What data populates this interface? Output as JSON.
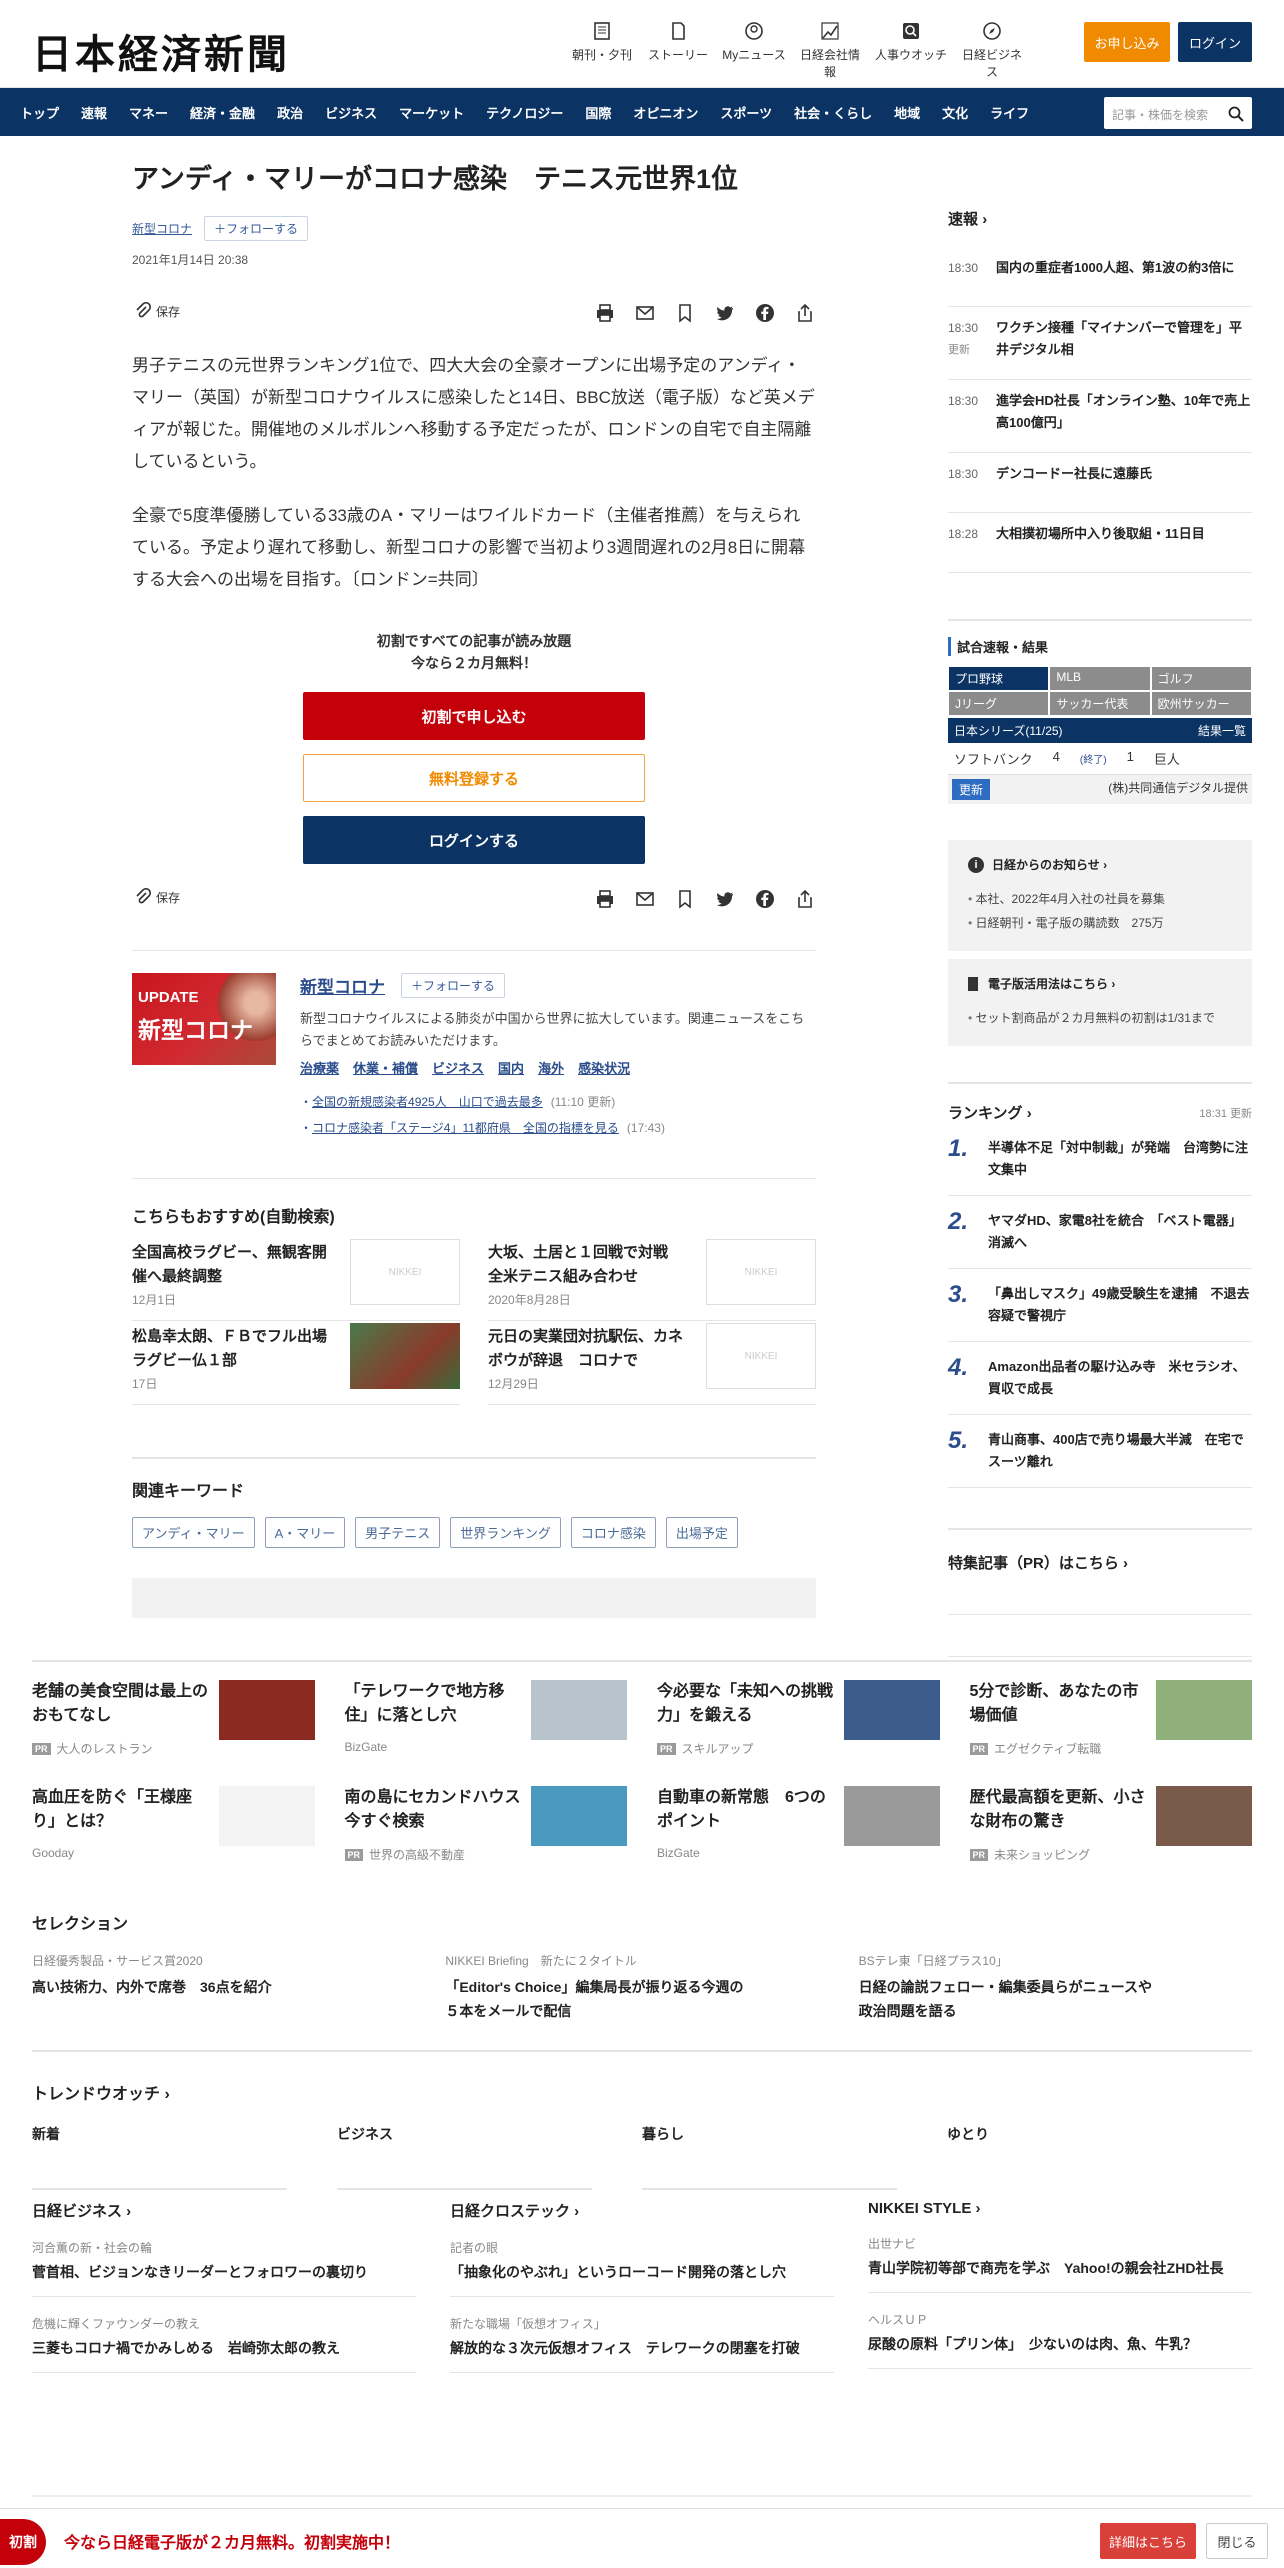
{
  "header": {
    "logo": "日本経済新聞",
    "nav": [
      {
        "label": "朝刊・夕刊",
        "icon": "newspaper-icon"
      },
      {
        "label": "ストーリー",
        "icon": "story-icon"
      },
      {
        "label": "Myニュース",
        "icon": "user-icon"
      },
      {
        "label": "日経会社情報",
        "icon": "chart-icon"
      },
      {
        "label": "人事ウオッチ",
        "icon": "search-person-icon"
      },
      {
        "label": "日経ビジネス",
        "icon": "compass-icon"
      }
    ],
    "apply_label": "お申し込み",
    "login_label": "ログイン"
  },
  "gnav": {
    "items": [
      "トップ",
      "速報",
      "マネー",
      "経済・金融",
      "政治",
      "ビジネス",
      "マーケット",
      "テクノロジー",
      "国際",
      "オピニオン",
      "スポーツ",
      "社会・くらし",
      "地域",
      "文化",
      "ライフ"
    ],
    "search_placeholder": "記事・株価を検索"
  },
  "article": {
    "title": "アンディ・マリーがコロナ感染　テニス元世界1位",
    "topic": "新型コロナ",
    "follow": "フォローする",
    "date": "2021年1月14日 20:38",
    "save": "保存",
    "paragraphs": [
      "男子テニスの元世界ランキング1位で、四大大会の全豪オープンに出場予定のアンディ・マリー（英国）が新型コロナウイルスに感染したと14日、BBC放送（電子版）など英メディアが報じた。開催地のメルボルンへ移動する予定だったが、ロンドンの自宅で自主隔離しているという。",
      "全豪で5度準優勝している33歳のA・マリーはワイルドカード（主催者推薦）を与えられている。予定より遅れて移動し、新型コロナの影響で当初より3週間遅れの2月8日に開幕する大会への出場を目指す。〔ロンドン=共同〕"
    ]
  },
  "paywall": {
    "line1": "初割ですべての記事が読み放題",
    "line2": "今なら２カ月無料！",
    "btn1": "初割で申し込む",
    "btn2": "無料登録する",
    "btn3": "ログインする"
  },
  "topic_box": {
    "img_update": "UPDATE",
    "img_caption": "新型コロナ",
    "title": "新型コロナ",
    "follow": "フォローする",
    "desc": "新型コロナウイルスによる肺炎が中国から世界に拡大しています。関連ニュースをこちらでまとめてお読みいただけます。",
    "tags": [
      "治療薬",
      "休業・補償",
      "ビジネス",
      "国内",
      "海外",
      "感染状況"
    ],
    "links": [
      {
        "text": "全国の新規感染者4925人　山口で過去最多",
        "time": "(11:10 更新)"
      },
      {
        "text": "コロナ感染者「ステージ4」11都府県　全国の指標を見る",
        "time": "(17:43)"
      }
    ]
  },
  "recommend": {
    "heading": "こちらもおすすめ(自動検索)",
    "items": [
      {
        "title": "全国高校ラグビー、無観客開催へ最終調整",
        "date": "12月1日",
        "img": "NIKKEI"
      },
      {
        "title": "大坂、土居と１回戦で対戦　全米テニス組み合わせ",
        "date": "2020年8月28日",
        "img": "NIKKEI"
      },
      {
        "title": "松島幸太朗、ＦＢでフル出場　ラグビー仏１部",
        "date": "17日",
        "img": ""
      },
      {
        "title": "元日の実業団対抗駅伝、カネボウが辞退　コロナで",
        "date": "12月29日",
        "img": "NIKKEI"
      }
    ]
  },
  "keywords": {
    "heading": "関連キーワード",
    "items": [
      "アンディ・マリー",
      "A・マリー",
      "男子テニス",
      "世界ランキング",
      "コロナ感染",
      "出場予定"
    ]
  },
  "sidebar": {
    "sokuho_heading": "速報",
    "sokuho": [
      {
        "time": "18:30",
        "sub": "",
        "text": "国内の重症者1000人超、第1波の約3倍に"
      },
      {
        "time": "18:30",
        "sub": "更新",
        "text": "ワクチン接種「マイナンバーで管理を」平井デジタル相"
      },
      {
        "time": "18:30",
        "sub": "",
        "text": "進学会HD社長「オンライン塾、10年で売上高100億円」"
      },
      {
        "time": "18:30",
        "sub": "",
        "text": "デンコードー社長に遠藤氏"
      },
      {
        "time": "18:28",
        "sub": "",
        "text": "大相撲初場所中入り後取組・11日目"
      }
    ],
    "score": {
      "heading": "試合速報・結果",
      "tabs": [
        "プロ野球",
        "MLB",
        "ゴルフ",
        "Jリーグ",
        "サッカー代表",
        "欧州サッカー"
      ],
      "bar_left": "日本シリーズ(11/25)",
      "bar_right": "結果一覧",
      "row": {
        "home": "ソフトバンク",
        "hs": "4",
        "status": "(終了)",
        "as": "1",
        "away": "巨人"
      },
      "update": "更新",
      "provider": "(株)共同通信デジタル提供"
    },
    "notice": {
      "heading": "日経からのお知らせ",
      "items": [
        "本社、2022年4月入社の社員を募集",
        "日経朝刊・電子版の購読数　275万"
      ]
    },
    "notice2": {
      "heading": "電子版活用法はこちら",
      "items": [
        "セット割商品が２カ月無料の初割は1/31まで"
      ]
    },
    "ranking": {
      "heading": "ランキング",
      "time": "18:31 更新",
      "items": [
        {
          "n": "1.",
          "t": "半導体不足「対中制裁」が発端　台湾勢に注文集中"
        },
        {
          "n": "2.",
          "t": "ヤマダHD、家電8社を統合　「ベスト電器」消滅へ"
        },
        {
          "n": "3.",
          "t": "「鼻出しマスク」49歳受験生を逮捕　不退去容疑で警視庁"
        },
        {
          "n": "4.",
          "t": "Amazon出品者の駆け込み寺　米セラシオ、買収で成長"
        },
        {
          "n": "5.",
          "t": "青山商事、400店で売り場最大半減　在宅でスーツ離れ"
        }
      ]
    },
    "pr_heading": "特集記事（PR）はこちら"
  },
  "ads": [
    {
      "title": "老舗の美食空間は最上のおもてなし",
      "pr": true,
      "sponsor": "大人のレストラン",
      "color": "#8a2a20"
    },
    {
      "title": "「テレワークで地方移住」に落とし穴",
      "pr": false,
      "sponsor": "BizGate",
      "color": "#b8c4cc"
    },
    {
      "title": "今必要な「未知への挑戦力」を鍛える",
      "pr": true,
      "sponsor": "スキルアップ",
      "color": "#3b5c8c"
    },
    {
      "title": "5分で診断、あなたの市場価値",
      "pr": true,
      "sponsor": "エグゼクティブ転職",
      "color": "#8fb07a"
    },
    {
      "title": "高血圧を防ぐ「王様座り」とは？",
      "pr": false,
      "sponsor": "Gooday",
      "color": "#f3f3f3"
    },
    {
      "title": "南の島にセカンドハウス　今すぐ検索",
      "pr": true,
      "sponsor": "世界の高級不動産",
      "color": "#4a9ac0"
    },
    {
      "title": "自動車の新常態　6つのポイント",
      "pr": false,
      "sponsor": "BizGate",
      "color": "#9a9a9a"
    },
    {
      "title": "歴代最高額を更新、小さな財布の驚き",
      "pr": true,
      "sponsor": "未来ショッピング",
      "color": "#7a5a4a"
    }
  ],
  "selection": {
    "heading": "セレクション",
    "items": [
      {
        "a": "日経優秀製品・サービス賞2020",
        "b": "高い技術力、内外で席巻　36点を紹介"
      },
      {
        "a": "NIKKEI Briefing　新たに２タイトル",
        "b": "「Editor's Choice」編集局長が振り返る今週の５本をメールで配信"
      },
      {
        "a": "BSテレ東「日経プラス10」",
        "b": "日経の論説フェロー・編集委員らがニュースや政治問題を語る"
      }
    ]
  },
  "trend": {
    "heading": "トレンドウオッチ",
    "items": [
      "新着",
      "ビジネス",
      "暮らし",
      "ゆとり"
    ]
  },
  "media": [
    {
      "heading": "日経ビジネス",
      "items": [
        {
          "a": "河合薫の新・社会の輪",
          "b": "菅首相、ビジョンなきリーダーとフォロワーの裏切り"
        },
        {
          "a": "危機に輝くファウンダーの教え",
          "b": "三菱もコロナ禍でかみしめる　岩崎弥太郎の教え"
        }
      ]
    },
    {
      "heading": "日経クロステック",
      "items": [
        {
          "a": "記者の眼",
          "b": "「抽象化のやぶれ」というローコード開発の落とし穴"
        },
        {
          "a": "新たな職場「仮想オフィス」",
          "b": "解放的な３次元仮想オフィス　テレワークの閉塞を打破"
        }
      ]
    },
    {
      "heading": "NIKKEI STYLE",
      "items": [
        {
          "a": "出世ナビ",
          "b": "青山学院初等部で商売を学ぶ　Yahoo!の親会社ZHD社長"
        },
        {
          "a": "ヘルスＵＰ",
          "b": "尿酸の原料「プリン体」　少ないのは肉、魚、牛乳？"
        }
      ]
    }
  ],
  "bottom_bar": {
    "stamp": "初割",
    "message": "今なら日経電子版が２カ月無料。初割実施中！",
    "detail": "詳細はこちら",
    "close": "閉じる"
  }
}
